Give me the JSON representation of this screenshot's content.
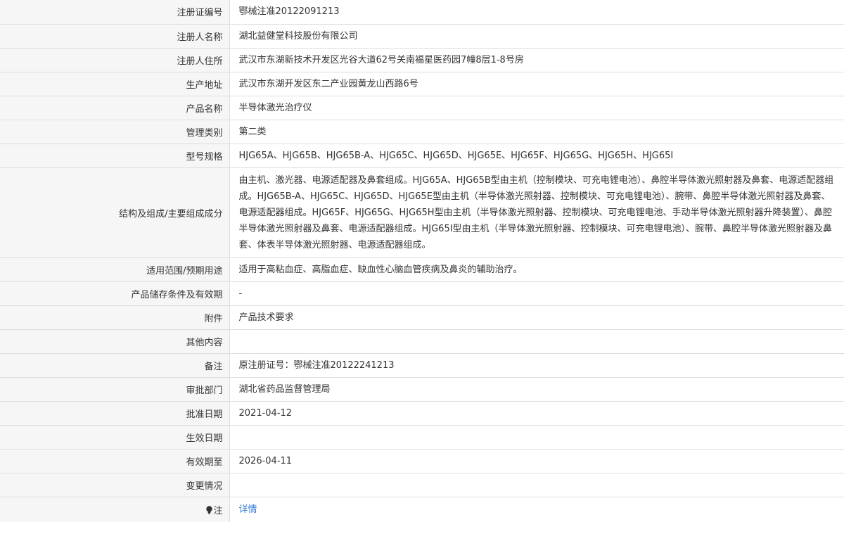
{
  "rows": [
    {
      "label": "注册证编号",
      "value": "鄂械注准20122091213"
    },
    {
      "label": "注册人名称",
      "value": "湖北益健堂科技股份有限公司"
    },
    {
      "label": "注册人住所",
      "value": "武汉市东湖新技术开发区光谷大道62号关南福星医药园7幢8层1-8号房"
    },
    {
      "label": "生产地址",
      "value": "武汉市东湖开发区东二产业园黄龙山西路6号"
    },
    {
      "label": "产品名称",
      "value": "半导体激光治疗仪"
    },
    {
      "label": "管理类别",
      "value": "第二类"
    },
    {
      "label": "型号规格",
      "value": "HJG65A、HJG65B、HJG65B-A、HJG65C、HJG65D、HJG65E、HJG65F、HJG65G、HJG65H、HJG65I"
    },
    {
      "label": "结构及组成/主要组成成分",
      "value": "由主机、激光器、电源适配器及鼻套组成。HJG65A、HJG65B型由主机（控制模块、可充电锂电池）、鼻腔半导体激光照射器及鼻套、电源适配器组成。HJG65B-A、HJG65C、HJG65D、HJG65E型由主机（半导体激光照射器、控制模块、可充电锂电池）、腕带、鼻腔半导体激光照射器及鼻套、电源适配器组成。HJG65F、HJG65G、HJG65H型由主机（半导体激光照射器、控制模块、可充电锂电池、手动半导体激光照射器升降装置）、鼻腔半导体激光照射器及鼻套、电源适配器组成。HJG65I型由主机（半导体激光照射器、控制模块、可充电锂电池）、腕带、鼻腔半导体激光照射器及鼻套、体表半导体激光照射器、电源适配器组成。"
    },
    {
      "label": "适用范围/预期用途",
      "value": "适用于高粘血症、高脂血症、缺血性心脑血管疾病及鼻炎的辅助治疗。"
    },
    {
      "label": "产品储存条件及有效期",
      "value": "-"
    },
    {
      "label": "附件",
      "value": "产品技术要求"
    },
    {
      "label": "其他内容",
      "value": ""
    },
    {
      "label": "备注",
      "value": "原注册证号：鄂械注准20122241213"
    },
    {
      "label": "审批部门",
      "value": "湖北省药品监督管理局"
    },
    {
      "label": "批准日期",
      "value": "2021-04-12"
    },
    {
      "label": "生效日期",
      "value": ""
    },
    {
      "label": "有效期至",
      "value": "2026-04-11"
    },
    {
      "label": "变更情况",
      "value": ""
    },
    {
      "label": "注",
      "value": "详情"
    }
  ],
  "icons": {
    "note": "lightbulb-icon"
  },
  "colors": {
    "label_bg": "#f6f6f6",
    "border": "#dddddd",
    "text": "#333333",
    "link": "#2f7bd6"
  }
}
